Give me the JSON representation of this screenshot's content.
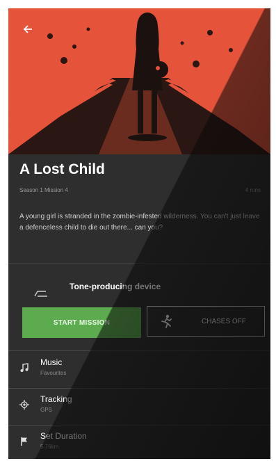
{
  "mission": {
    "title": "A Lost Child",
    "season_label": "Season 1 Mission 4",
    "runs_label": "4 runs",
    "description": "A young girl is stranded in the zombie-infested wilderness. You can't just leave a defenceless child to die out there... can you?"
  },
  "device": {
    "label": "Tone-producing device",
    "icon": "tone-device-icon"
  },
  "actions": {
    "start_label": "START MISSION",
    "chases_label": "CHASES OFF",
    "chases_icon": "running-person-icon"
  },
  "settings": [
    {
      "label": "Music",
      "value": "Favourites",
      "icon": "music-note-icon"
    },
    {
      "label": "Tracking",
      "value": "GPS",
      "icon": "gps-target-icon"
    },
    {
      "label": "Set Duration",
      "value": "5.76km",
      "icon": "flag-icon"
    }
  ],
  "colors": {
    "hero_red": "#e5533a",
    "start_green": "#5cac4f",
    "background": "#2e2e2e"
  }
}
